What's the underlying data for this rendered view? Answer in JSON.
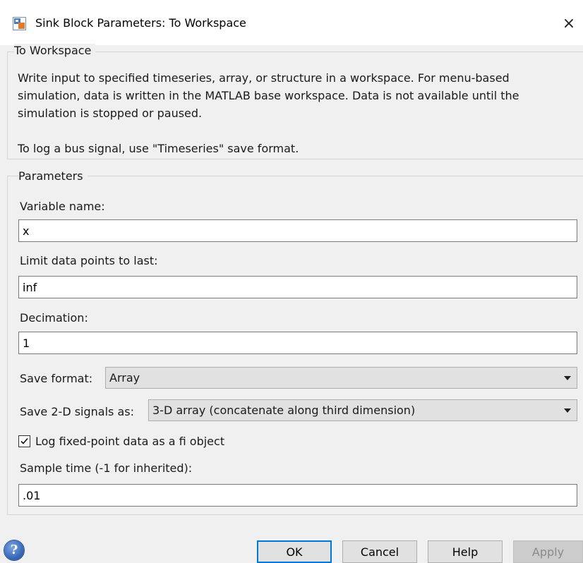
{
  "window": {
    "title": "Sink Block Parameters: To Workspace",
    "close_label": "×"
  },
  "block": {
    "group_title": "To Workspace",
    "description": [
      "Write input to specified timeseries, array, or structure in a workspace. For menu-based simulation, data is written in the MATLAB base workspace. Data is not available until the simulation is stopped or paused.",
      "To log a bus signal, use \"Timeseries\" save format."
    ]
  },
  "parameters": {
    "group_title": "Parameters",
    "variable_name": {
      "label": "Variable name:",
      "value": "x"
    },
    "limit_data_points": {
      "label": "Limit data points to last:",
      "value": "inf"
    },
    "decimation": {
      "label": "Decimation:",
      "value": "1"
    },
    "save_format": {
      "label": "Save format:",
      "selected": "Array"
    },
    "save_2d_signals": {
      "label": "Save 2-D signals as:",
      "selected": "3-D array (concatenate along third dimension)"
    },
    "log_fixed_point": {
      "label": "Log fixed-point data as a fi object",
      "checked": true
    },
    "sample_time": {
      "label": "Sample time (-1 for inherited):",
      "value": ".01"
    }
  },
  "buttons": {
    "help_icon": "?",
    "ok": "OK",
    "cancel": "Cancel",
    "help": "Help",
    "apply": "Apply"
  },
  "colors": {
    "focus_accent": "#0078d7",
    "window_bg": "#f0f0f0"
  }
}
